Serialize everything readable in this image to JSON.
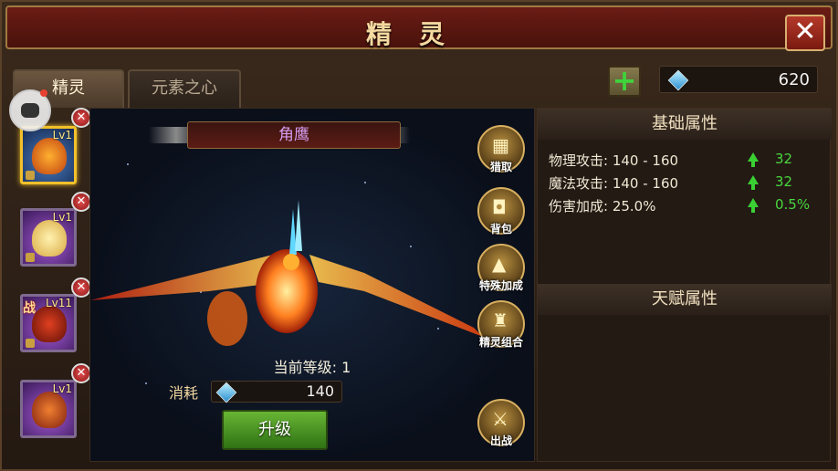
{
  "header": {
    "title": "精灵",
    "close_icon": "close-icon"
  },
  "tabs": [
    {
      "label": "精灵",
      "active": true
    },
    {
      "label": "元素之心",
      "active": false
    }
  ],
  "currency": {
    "icon": "diamond-icon",
    "value": "620",
    "add_icon": "plus-icon"
  },
  "sprites": [
    {
      "level": "Lv1",
      "selected": true,
      "locked": true,
      "tag": ""
    },
    {
      "level": "Lv1",
      "selected": false,
      "locked": true,
      "tag": ""
    },
    {
      "level": "Lv11",
      "selected": false,
      "locked": true,
      "tag": "战"
    },
    {
      "level": "Lv1",
      "selected": false,
      "locked": false,
      "tag": ""
    }
  ],
  "scene": {
    "name": "角鹰",
    "level_text": "当前等级: 1",
    "cost_label": "消耗",
    "cost_value": "140",
    "upgrade_label": "升级"
  },
  "side_buttons": [
    {
      "label": "猎取",
      "icon": "net-icon"
    },
    {
      "label": "背包",
      "icon": "bag-icon"
    },
    {
      "label": "特殊加成",
      "icon": "spear-icon"
    },
    {
      "label": "精灵组合",
      "icon": "helmet-icon"
    },
    {
      "label": "出战",
      "icon": "sword-icon"
    }
  ],
  "attributes": {
    "base_title": "基础属性",
    "talent_title": "天赋属性",
    "stats": [
      {
        "text": "物理攻击: 140 - 160",
        "bonus": "32"
      },
      {
        "text": "魔法攻击: 140 - 160",
        "bonus": "32"
      },
      {
        "text": "伤害加成: 25.0%",
        "bonus": "0.5%"
      }
    ]
  },
  "colors": {
    "accent_gold": "#f2c02a",
    "bonus_green": "#49d63e",
    "name_purple": "#d59cf0"
  }
}
